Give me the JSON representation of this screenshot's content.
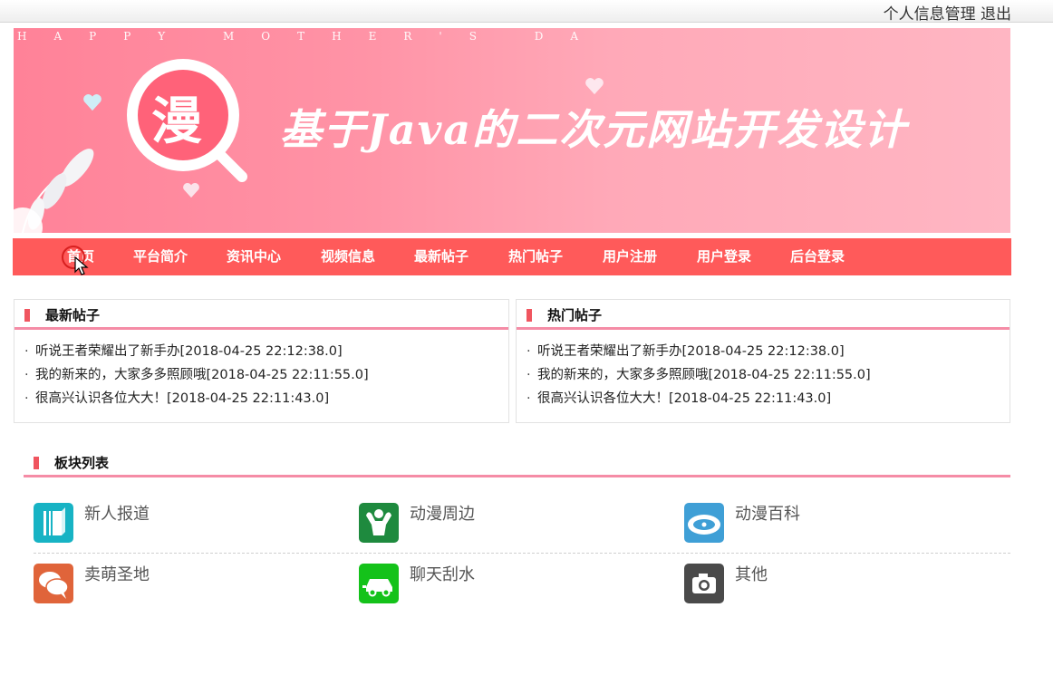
{
  "topbar": {
    "profile": "个人信息管理",
    "logout": "退出"
  },
  "banner": {
    "tagline": "HAPPY MOTHER'S DA",
    "title": "基于Java的二次元网站开发设计",
    "logo_char": "漫"
  },
  "nav": {
    "items": [
      "首页",
      "平台简介",
      "资讯中心",
      "视频信息",
      "最新帖子",
      "热门帖子",
      "用户注册",
      "用户登录",
      "后台登录"
    ]
  },
  "latest": {
    "title": "最新帖子",
    "posts": [
      "听说王者荣耀出了新手办[2018-04-25 22:12:38.0]",
      "我的新来的，大家多多照顾哦[2018-04-25 22:11:55.0]",
      "很高兴认识各位大大！[2018-04-25 22:11:43.0]"
    ]
  },
  "hot": {
    "title": "热门帖子",
    "posts": [
      "听说王者荣耀出了新手办[2018-04-25 22:12:38.0]",
      "我的新来的，大家多多照顾哦[2018-04-25 22:11:55.0]",
      "很高兴认识各位大大！[2018-04-25 22:11:43.0]"
    ]
  },
  "boards": {
    "title": "板块列表",
    "items": [
      {
        "name": "新人报道",
        "icon": "book-icon",
        "color": "#17b3c4"
      },
      {
        "name": "动漫周边",
        "icon": "muscle-icon",
        "color": "#1e8a3e"
      },
      {
        "name": "动漫百科",
        "icon": "film-reel-icon",
        "color": "#3f9fd6"
      },
      {
        "name": "卖萌圣地",
        "icon": "chat-bubbles-icon",
        "color": "#e0643a"
      },
      {
        "name": "聊天刮水",
        "icon": "car-icon",
        "color": "#14c21a"
      },
      {
        "name": "其他",
        "icon": "camera-icon",
        "color": "#4a4a4a"
      }
    ]
  },
  "colors": {
    "nav_bg": "#ff5a5a",
    "accent_line": "#f58ca6",
    "marker": "#f0555f"
  }
}
